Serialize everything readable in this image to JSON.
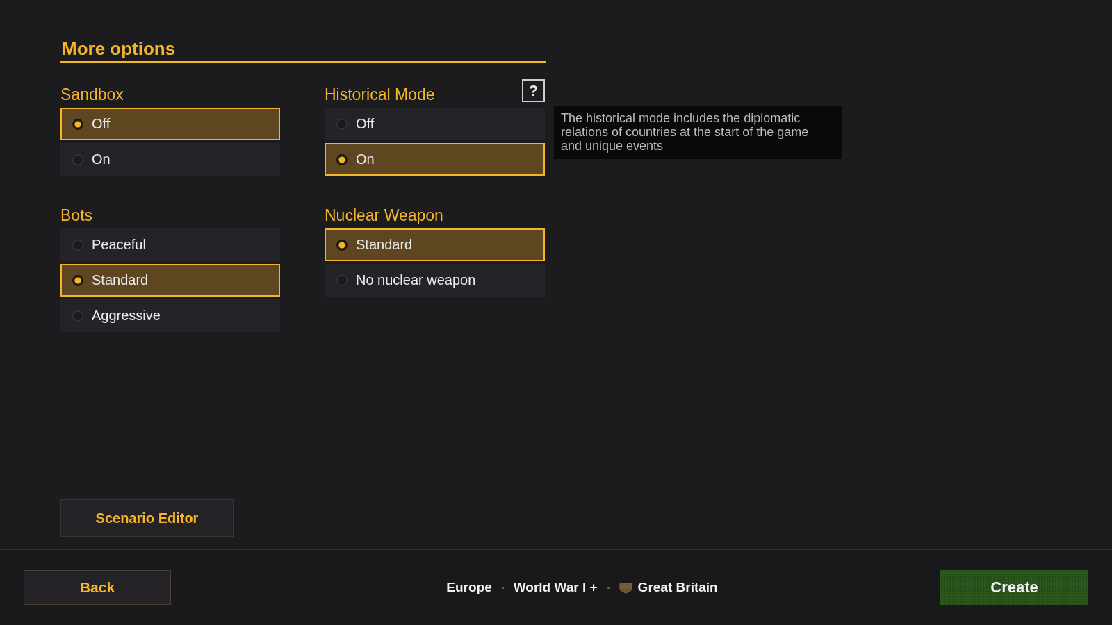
{
  "title": "More options",
  "groups": [
    {
      "label": "Sandbox",
      "options": [
        {
          "label": "Off",
          "selected": true
        },
        {
          "label": "On",
          "selected": false
        }
      ]
    },
    {
      "label": "Historical Mode",
      "help_button": "?",
      "tooltip": "The historical mode includes the diplomatic relations of countries at the start of the game and unique events",
      "options": [
        {
          "label": "Off",
          "selected": false
        },
        {
          "label": "On",
          "selected": true
        }
      ]
    },
    {
      "label": "Bots",
      "options": [
        {
          "label": "Peaceful",
          "selected": false
        },
        {
          "label": "Standard",
          "selected": true
        },
        {
          "label": "Aggressive",
          "selected": false
        }
      ]
    },
    {
      "label": "Nuclear Weapon",
      "options": [
        {
          "label": "Standard",
          "selected": true
        },
        {
          "label": "No nuclear weapon",
          "selected": false
        }
      ]
    }
  ],
  "scenario_button": "Scenario Editor",
  "footer": {
    "back_button": "Back",
    "summary": [
      {
        "text": "Europe",
        "kind": "plain"
      },
      {
        "text": "World War I +",
        "kind": "plain"
      },
      {
        "text": "Great Britain",
        "kind": "country"
      }
    ],
    "create_button": "Create"
  }
}
